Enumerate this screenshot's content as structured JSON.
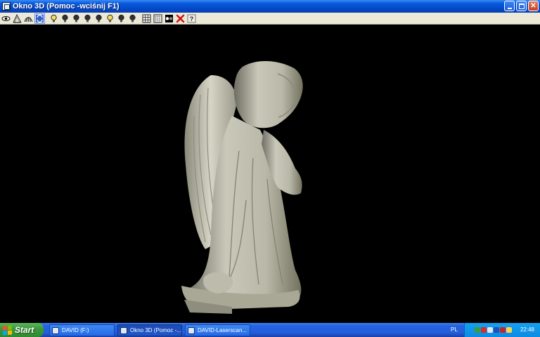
{
  "window": {
    "title": "Okno 3D (Pomoc -wciśnij F1)"
  },
  "toolbar": {
    "groups": [
      [
        "eye-icon",
        "laser-scan-icon",
        "texture-icon",
        "sync-icon"
      ],
      [
        "light-icon",
        "light-icon",
        "light-icon",
        "light-icon",
        "light-icon",
        "light-icon",
        "light-icon",
        "light-icon"
      ],
      [
        "grid-icon",
        "grid-fine-icon",
        "contrast-icon",
        "delete-icon",
        "help-icon"
      ]
    ],
    "pressed_index": 3,
    "colors": {
      "delete": "#d01010",
      "light_on": "#f4e060",
      "light_off": "#303030"
    }
  },
  "viewport": {
    "background": "#000000",
    "model_color": "#c8c7b8"
  },
  "taskbar": {
    "start_label": "Start",
    "tasks": [
      {
        "label": "DAVID (F:)",
        "active": false
      },
      {
        "label": "Okno 3D (Pomoc -...",
        "active": true
      },
      {
        "label": "DAVID-Laserscan...",
        "active": false
      }
    ],
    "language": "PL",
    "clock": "22:48"
  }
}
